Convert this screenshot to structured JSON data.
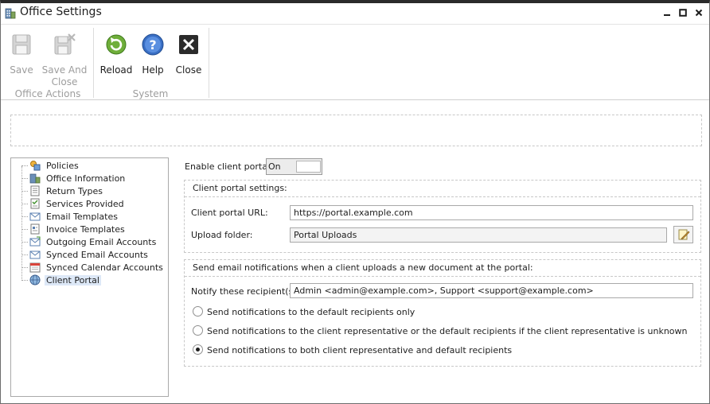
{
  "window": {
    "title": "Office Settings"
  },
  "ribbon": {
    "groups": [
      {
        "label": "Office Actions"
      },
      {
        "label": "System"
      }
    ],
    "buttons": {
      "save": "Save",
      "save_and_close_1": "Save And",
      "save_and_close_2": "Close",
      "reload": "Reload",
      "help": "Help",
      "close": "Close"
    }
  },
  "tree": {
    "items": [
      {
        "label": "Policies",
        "icon": "policies-icon"
      },
      {
        "label": "Office Information",
        "icon": "building-icon"
      },
      {
        "label": "Return Types",
        "icon": "document-icon"
      },
      {
        "label": "Services Provided",
        "icon": "checklist-icon"
      },
      {
        "label": "Email Templates",
        "icon": "email-icon"
      },
      {
        "label": "Invoice Templates",
        "icon": "invoice-icon"
      },
      {
        "label": "Outgoing Email Accounts",
        "icon": "outgoing-email-icon"
      },
      {
        "label": "Synced Email Accounts",
        "icon": "synced-email-icon"
      },
      {
        "label": "Synced Calendar Accounts",
        "icon": "calendar-icon"
      },
      {
        "label": "Client Portal",
        "icon": "globe-icon",
        "selected": true
      }
    ]
  },
  "portal": {
    "enable_label": "Enable client portal:",
    "toggle_value": "On",
    "settings_title": "Client portal settings:",
    "url_label": "Client portal URL:",
    "url_value": "https://portal.example.com",
    "folder_label": "Upload folder:",
    "folder_value": "Portal Uploads",
    "notify_title": "Send email notifications when a client uploads a new document at the portal:",
    "recipients_label": "Notify these recipient(s):",
    "recipients_value": "Admin <admin@example.com>, Support <support@example.com>",
    "options": [
      {
        "label": "Send notifications to the default recipients only",
        "checked": false
      },
      {
        "label": "Send notifications to the client representative or the default recipients if the client representative is unknown",
        "checked": false
      },
      {
        "label": "Send notifications to both client representative and default recipients",
        "checked": true
      }
    ]
  }
}
